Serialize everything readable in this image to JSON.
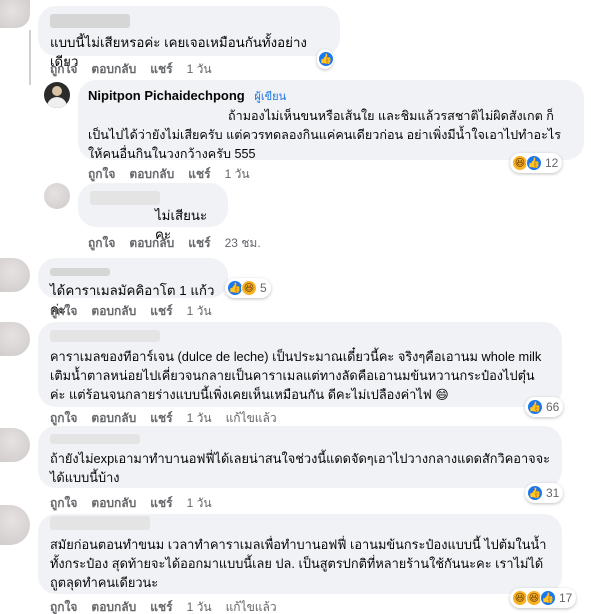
{
  "comments": [
    {
      "text": "แบบนี้ไม่เสียหรอค่ะ เคยเจอเหมือนกันทั้งอย่างเดียว",
      "actions": {
        "like": "ถูกใจ",
        "reply": "ตอบกลับ",
        "share": "แชร์",
        "time": "1 วัน"
      },
      "reactions": {
        "icons": [
          "like"
        ],
        "count": ""
      }
    },
    {
      "author": "Nipitpon Pichaidechpong",
      "badge": "ผู้เขียน",
      "text": "ถ้ามองไม่เห็นขนหรือเส้นใย และชิมแล้วรสชาติไม่ผิดสังเกต ก็เป็นไปได้ว่ายังไม่เสียครับ แต่ควรทดลองกินแค่คนเดียวก่อน อย่าเพิ่งมีน้ำใจเอาไปทำอะไรให้คนอื่นกินในวงกว้างครับ 555",
      "actions": {
        "like": "ถูกใจ",
        "reply": "ตอบกลับ",
        "share": "แชร์",
        "time": "1 วัน"
      },
      "reactions": {
        "icons": [
          "haha",
          "like"
        ],
        "count": "12"
      }
    },
    {
      "text": "ไม่เสียนะคะ",
      "actions": {
        "like": "ถูกใจ",
        "reply": "ตอบกลับ",
        "share": "แชร์",
        "time": "23 ชม."
      }
    },
    {
      "text": "ได้คาราเมลมัคคิอาโต 1 แก้วค่ะ",
      "actions": {
        "like": "ถูกใจ",
        "reply": "ตอบกลับ",
        "share": "แชร์",
        "time": "1 วัน"
      },
      "reactions": {
        "icons": [
          "like",
          "haha"
        ],
        "count": "5"
      }
    },
    {
      "text": "คาราเมลของทีอาร์เจน (dulce de leche) เป็นประมาณเดี๋ยวนี้คะ จริงๆคือเอานม whole milk เติมน้ำตาลหน่อยไปเคี่ยวจนกลายเป็นคาราเมลแต่ทางลัดคือเอานมข้นหวานกระป๋องไปตุ๋นค่ะ แต่ร้อนจนกลายร่างแบบนี้เพิ่งเคยเห็นเหมือนกัน ดีคะไม่เปลืองค่าไฟ 😄",
      "actions": {
        "like": "ถูกใจ",
        "reply": "ตอบกลับ",
        "share": "แชร์",
        "time": "1 วัน",
        "edited": "แก้ไขแล้ว"
      },
      "reactions": {
        "icons": [
          "like"
        ],
        "count": "66"
      }
    },
    {
      "text": "ถ้ายังไม่expเอามาทำบานอฟฟี่ได้เลยน่าสนใจช่วงนี้แดดจัดๆเอาไปวางกลางแดดสักวิคอาจจะได้แบบนี้บ้าง",
      "actions": {
        "like": "ถูกใจ",
        "reply": "ตอบกลับ",
        "share": "แชร์",
        "time": "1 วัน"
      },
      "reactions": {
        "icons": [
          "like"
        ],
        "count": "31"
      }
    },
    {
      "text": "สมัยก่อนตอนทำขนม เวลาทำคาราเมลเพื่อทำบานอฟฟี่ เอานมข้นกระป๋องแบบนี้ ไปต้มในน้ำทั้งกระป๋อง สุดท้ายจะได้ออกมาแบบนี้เลย ปล. เป็นสูตรปกติที่หลายร้านใช้กันนะคะ เราไม่ได้ถูตลุดทำคนเดียวนะ",
      "actions": {
        "like": "ถูกใจ",
        "reply": "ตอบกลับ",
        "share": "แชร์",
        "time": "1 วัน",
        "edited": "แก้ไขแล้ว"
      },
      "reactions": {
        "icons": [
          "haha",
          "haha",
          "like"
        ],
        "count": "17"
      }
    }
  ],
  "icon_names": {
    "like": "thumbs-up-icon",
    "haha": "laughing-face-icon"
  }
}
